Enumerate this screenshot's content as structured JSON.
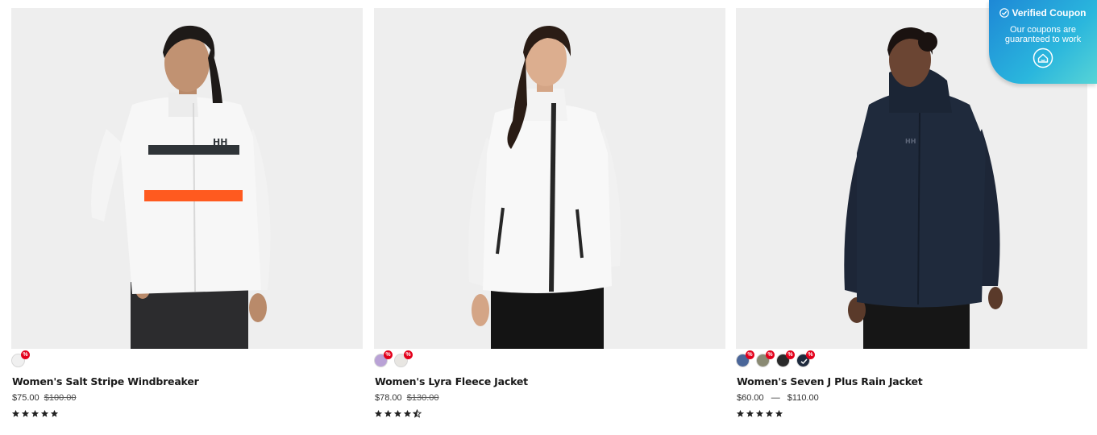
{
  "products": [
    {
      "name": "Women's Salt Stripe Windbreaker",
      "price": "$75.00",
      "old_price": "$100.00",
      "stars": "★★★★★",
      "rating_value": 5,
      "swatches": [
        {
          "color": "#f0f0f0",
          "sale": true,
          "sale_label": "%",
          "selected": false
        }
      ]
    },
    {
      "name": "Women's Lyra Fleece Jacket",
      "price": "$78.00",
      "old_price": "$130.00",
      "stars": "★★★★",
      "rating_value": 4.5,
      "swatches": [
        {
          "color": "#b9a2d6",
          "sale": true,
          "sale_label": "%",
          "selected": false
        },
        {
          "color": "#e8e6e2",
          "sale": true,
          "sale_label": "%",
          "selected": false
        }
      ]
    },
    {
      "name": "Women's Seven J Plus Rain Jacket",
      "price_from": "$60.00",
      "price_sep": "—",
      "price_to": "$110.00",
      "stars": "★★★★★",
      "rating_value": 5,
      "swatches": [
        {
          "color": "#4a6699",
          "sale": true,
          "sale_label": "%",
          "selected": false
        },
        {
          "color": "#8a8a73",
          "sale": true,
          "sale_label": "%",
          "selected": false
        },
        {
          "color": "#2a2a2a",
          "sale": true,
          "sale_label": "%",
          "selected": false
        },
        {
          "color": "#1e2a3d",
          "sale": true,
          "sale_label": "%",
          "selected": true
        }
      ]
    }
  ],
  "coupon": {
    "title": "Verified Coupon",
    "line1": "Our coupons are",
    "line2": "guaranteed to work",
    "icon": "home-chat-icon"
  },
  "colors": {
    "sale_badge": "#e3001b",
    "photo_bg": "#eeeeee",
    "coupon_gradient_start": "#1e88d6",
    "coupon_gradient_end": "#57d4d6"
  }
}
